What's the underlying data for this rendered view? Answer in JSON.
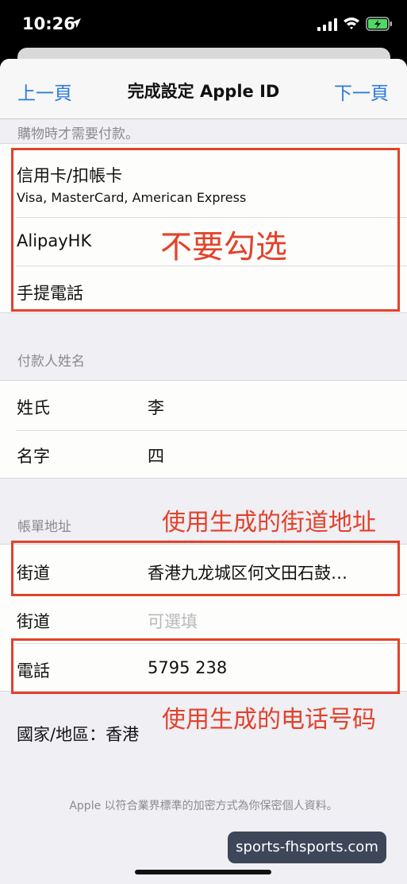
{
  "status_bar": {
    "time": "10:26"
  },
  "nav": {
    "back_label": "上一頁",
    "title": "完成設定 Apple ID",
    "next_label": "下一頁"
  },
  "payment": {
    "section_header": "購物時才需要付款。",
    "items": [
      {
        "label": "信用卡/扣帳卡",
        "sublabel": "Visa, MasterCard, American Express"
      },
      {
        "label": "AlipayHK"
      },
      {
        "label": "手提電話"
      }
    ],
    "annotation": "不要勾选"
  },
  "payer": {
    "section_header": "付款人姓名",
    "last_name": {
      "label": "姓氏",
      "value": "李"
    },
    "first_name": {
      "label": "名字",
      "value": "四"
    }
  },
  "billing": {
    "section_header": "帳單地址",
    "street1": {
      "label": "街道",
      "value": "香港九龙城区何文田石鼓…"
    },
    "street2": {
      "label": "街道",
      "placeholder": "可選填"
    },
    "phone": {
      "label": "電話",
      "value": "5795 238"
    },
    "country_region": "國家/地區：香港",
    "annotation_street": "使用生成的街道地址",
    "annotation_phone": "使用生成的电话号码"
  },
  "footer_note": "Apple 以符合業界標準的加密方式為你保密個人資料。",
  "watermark": "sports-fhsports.com",
  "colors": {
    "accent": "#2f7bdb",
    "annotation_red": "#e2422b",
    "background": "#efeff4"
  }
}
